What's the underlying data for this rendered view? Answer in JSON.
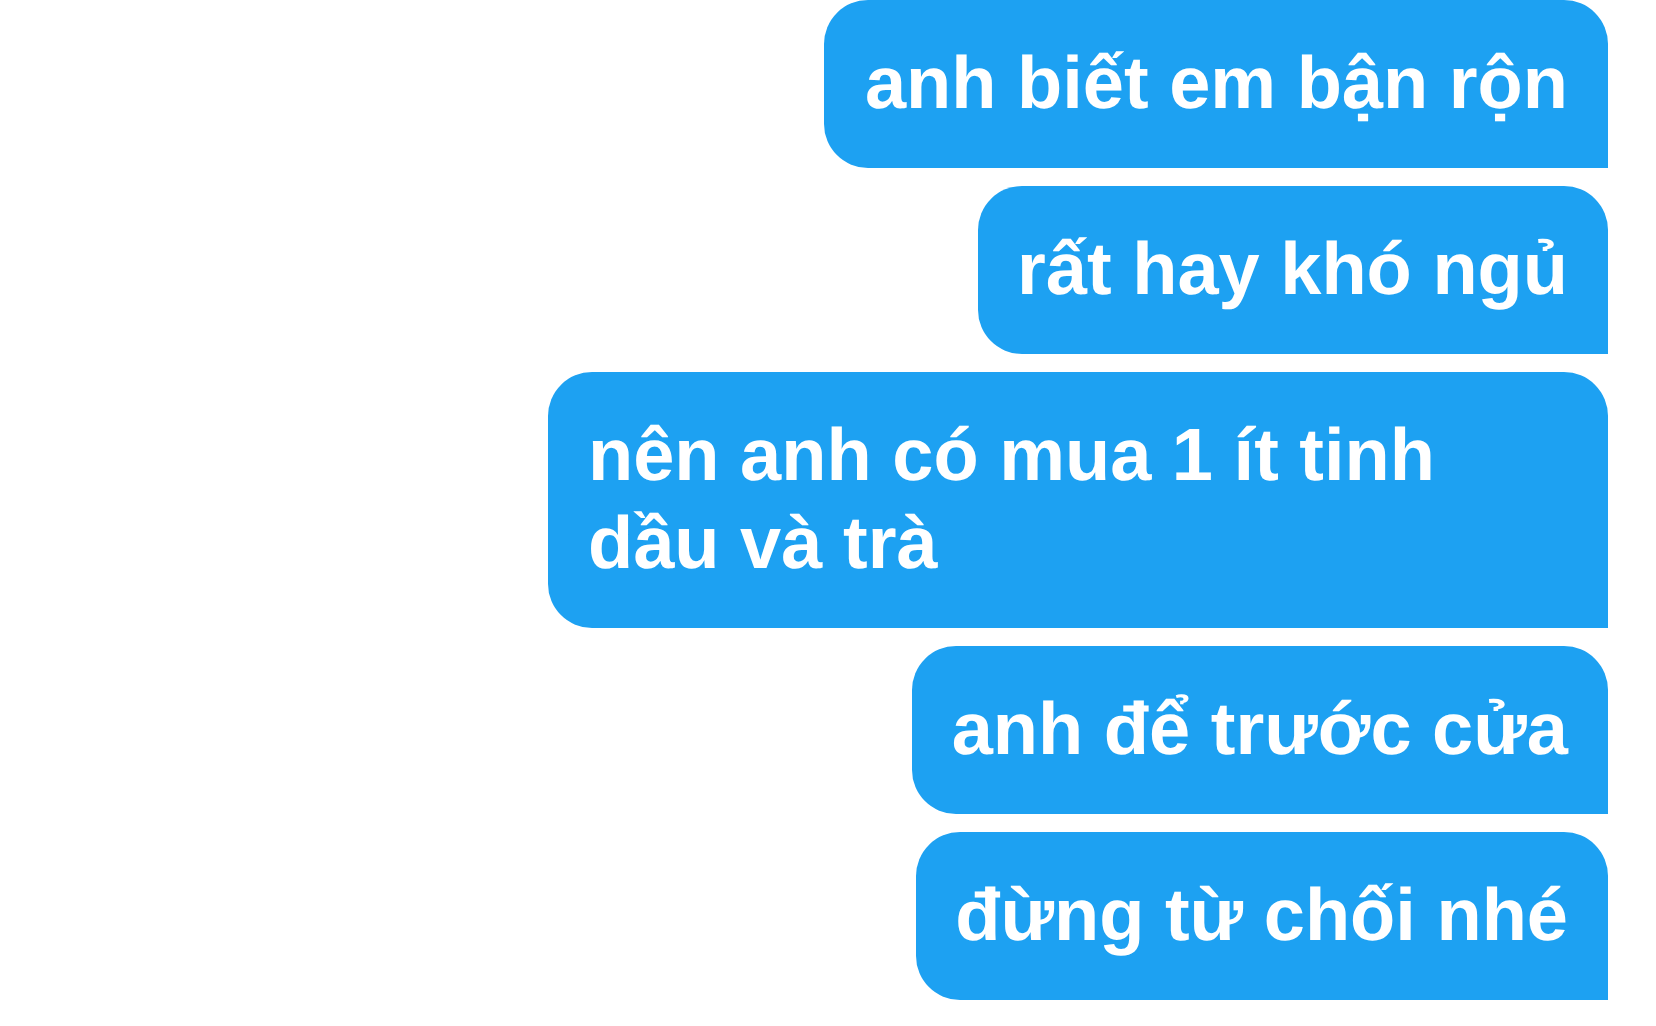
{
  "messages": [
    {
      "text": "anh biết em bận rộn",
      "sent": true
    },
    {
      "text": "rất hay khó ngủ",
      "sent": true
    },
    {
      "text": "nên anh có mua 1 ít tinh dầu và trà",
      "sent": true
    },
    {
      "text": "anh để trước cửa",
      "sent": true
    },
    {
      "text": "đừng từ chối nhé",
      "sent": true
    }
  ]
}
